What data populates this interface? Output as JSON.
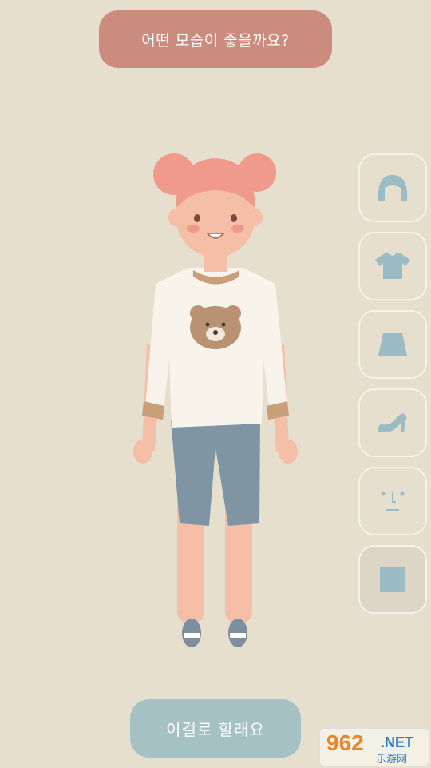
{
  "prompt": {
    "text": "어떤 모습이 좋을까요?"
  },
  "side_buttons": [
    {
      "icon": "hair-icon",
      "selected": false
    },
    {
      "icon": "top-shirt-icon",
      "selected": false
    },
    {
      "icon": "skirt-icon",
      "selected": false
    },
    {
      "icon": "shoe-icon",
      "selected": false
    },
    {
      "icon": "face-icon",
      "selected": false
    },
    {
      "icon": "background-square-icon",
      "selected": true
    }
  ],
  "confirm_button": {
    "label": "이걸로 할래요"
  },
  "watermark": {
    "number": "962",
    "suffix": ".NET",
    "site": "乐游网"
  },
  "colors": {
    "background": "#e6dfce",
    "prompt_bg": "#cc8c7d",
    "confirm_bg": "#a6c1c4",
    "icon": "#9bbcc4"
  }
}
